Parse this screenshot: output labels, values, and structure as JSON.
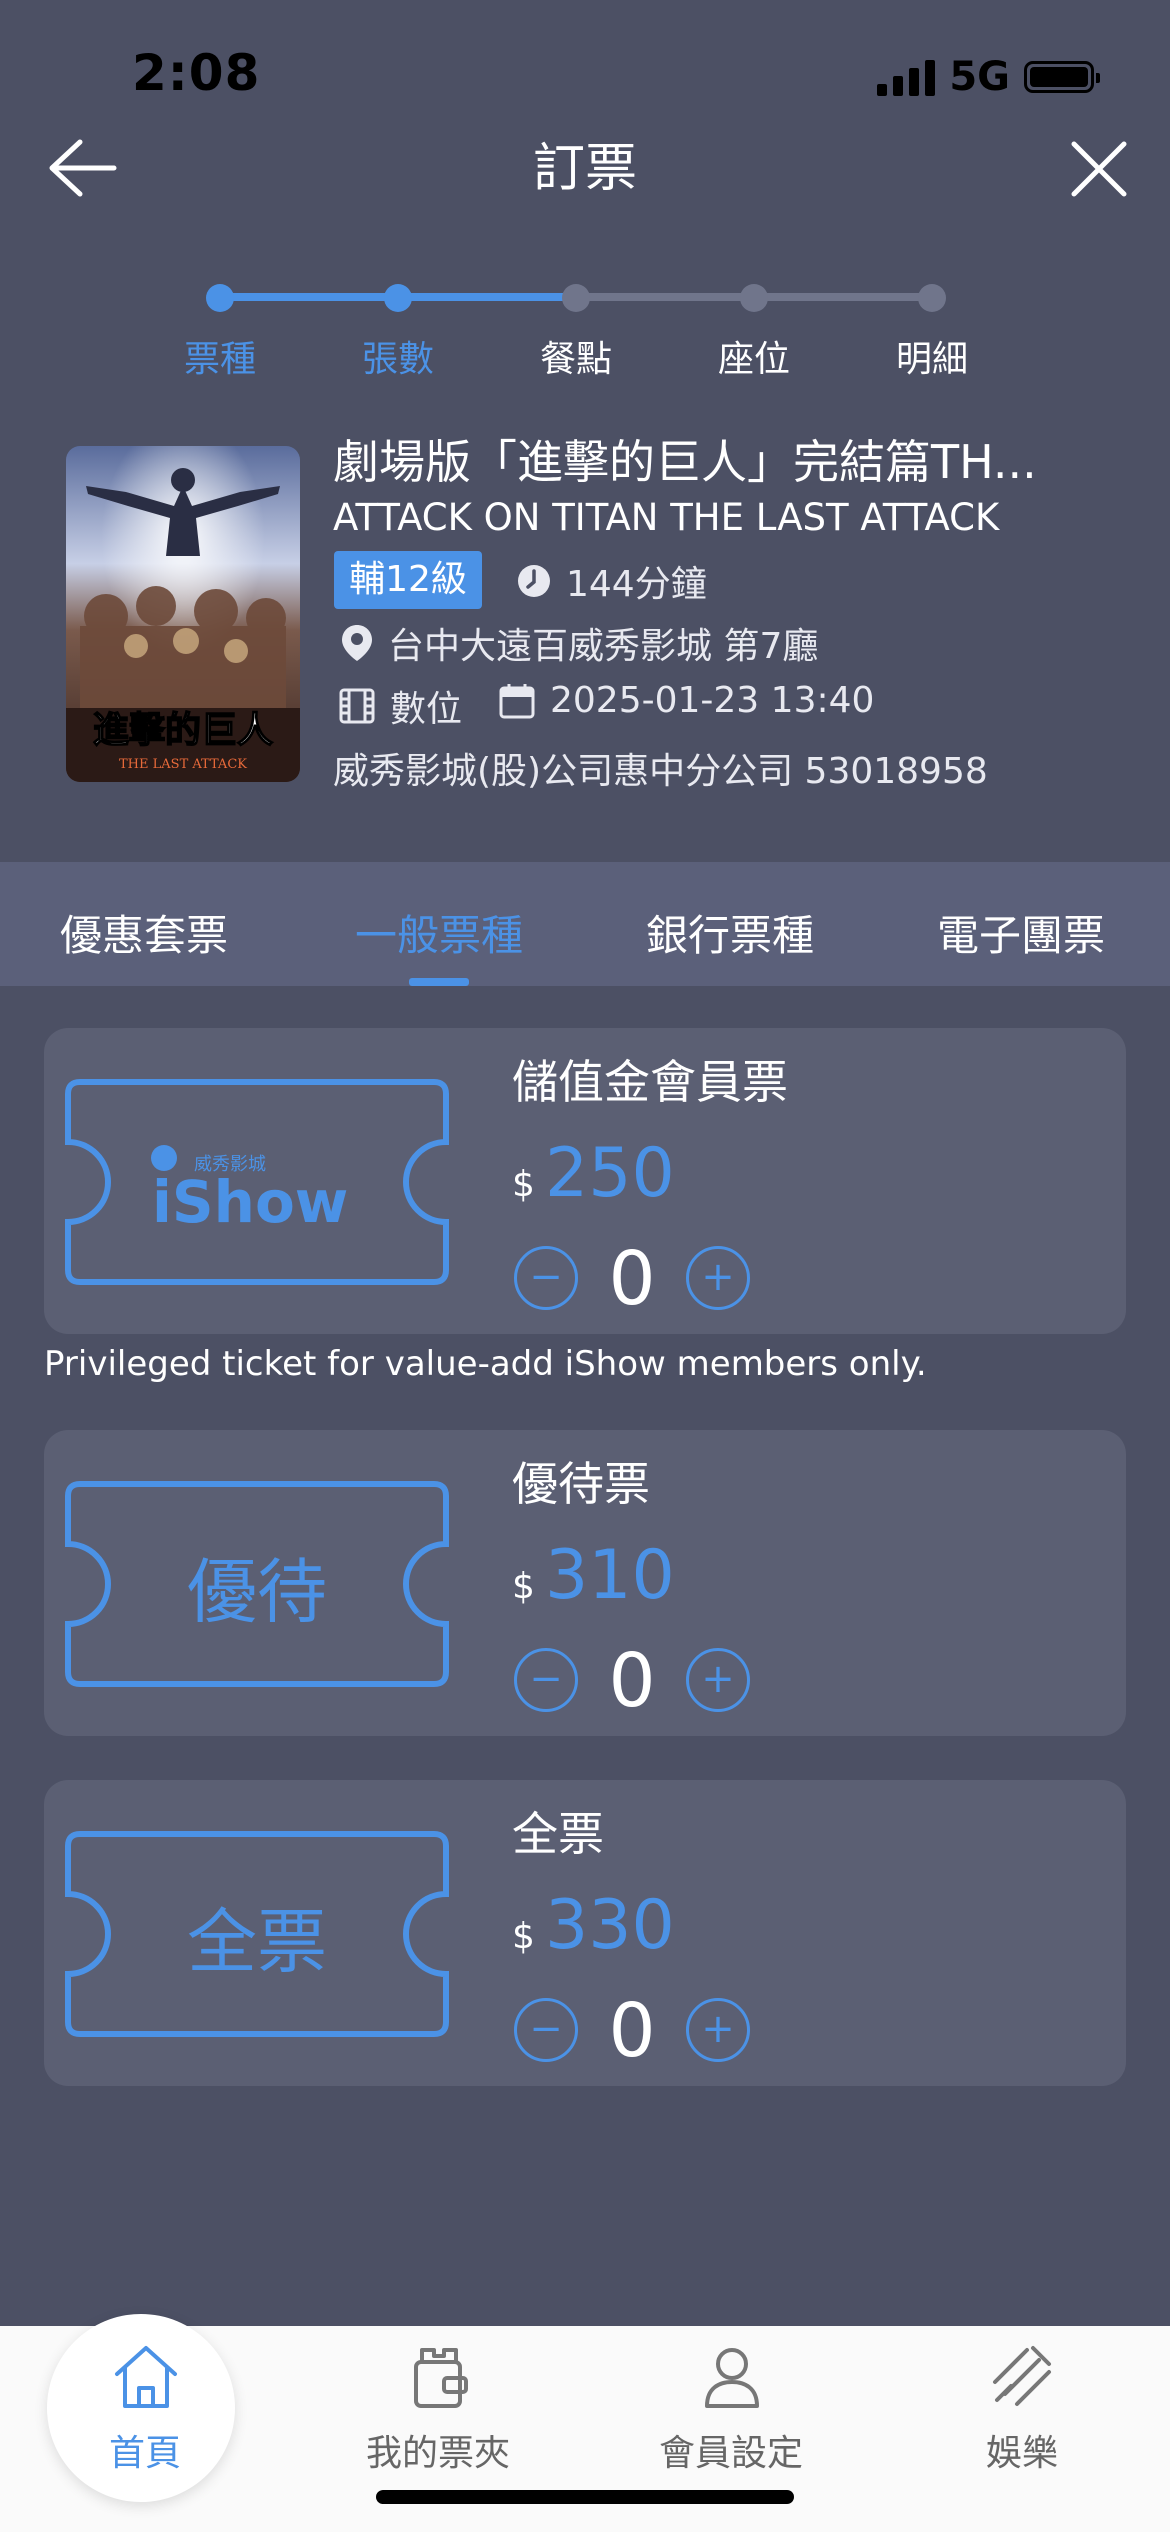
{
  "status_bar": {
    "time": "2:08",
    "network": "5G"
  },
  "header": {
    "title": "訂票",
    "back_icon": "arrow-left-icon",
    "close_icon": "close-icon"
  },
  "stepper": {
    "steps": [
      "票種",
      "張數",
      "餐點",
      "座位",
      "明細"
    ],
    "current_step": 2,
    "active_color": "#4b92e6",
    "inactive_color": "#70758b"
  },
  "movie": {
    "title": "劇場版「進擊的巨人」完結篇TH...",
    "title_en": "ATTACK ON TITAN THE LAST ATTACK",
    "rating": "輔12級",
    "duration": "144分鐘",
    "theater": "台中大遠百威秀影城 第7廳",
    "format": "數位",
    "datetime": "2025-01-23 13:40",
    "company": "威秀影城(股)公司惠中分公司 53018958",
    "poster_text": "進擊的巨人",
    "poster_subtext": "THE LAST ATTACK"
  },
  "tabs": {
    "items": [
      "優惠套票",
      "一般票種",
      "銀行票種",
      "電子團票"
    ],
    "active_index": 1
  },
  "tickets": [
    {
      "name": "儲值金會員票",
      "currency": "$",
      "price": "250",
      "quantity": "0",
      "ticket_label": "iShow",
      "ticket_small": "威秀影城",
      "minus": "−",
      "plus": "+"
    },
    {
      "name": "優待票",
      "currency": "$",
      "price": "310",
      "quantity": "0",
      "ticket_label": "優待",
      "minus": "−",
      "plus": "+"
    },
    {
      "name": "全票",
      "currency": "$",
      "price": "330",
      "quantity": "0",
      "ticket_label": "全票",
      "minus": "−",
      "plus": "+"
    }
  ],
  "member_note": "Privileged ticket for value-add iShow members only.",
  "bottom_nav": {
    "items": [
      {
        "label": "首頁",
        "icon": "home-icon",
        "active": true
      },
      {
        "label": "我的票夾",
        "icon": "wallet-icon",
        "active": false
      },
      {
        "label": "會員設定",
        "icon": "person-icon",
        "active": false
      },
      {
        "label": "娛樂",
        "icon": "entertainment-icon",
        "active": false
      }
    ]
  },
  "colors": {
    "accent": "#4b92e6",
    "background": "#4c5064",
    "card": "#5b5f73",
    "tab_bar": "#5b607a"
  }
}
